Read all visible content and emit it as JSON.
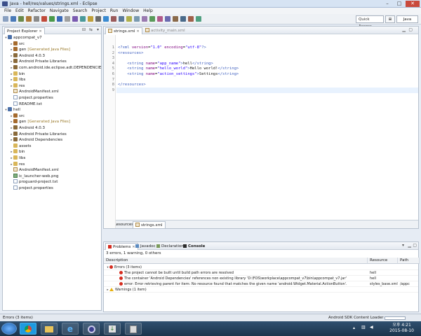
{
  "window": {
    "title": "Java - hell/res/values/strings.xml - Eclipse",
    "minimize": "–",
    "maximize": "□",
    "close": "✕"
  },
  "menu": [
    "File",
    "Edit",
    "Refactor",
    "Navigate",
    "Search",
    "Project",
    "Run",
    "Window",
    "Help"
  ],
  "toolbar": {
    "quick_access": "Quick Access",
    "perspective_java": "Java"
  },
  "explorer": {
    "title": "Project Explorer",
    "rows": [
      {
        "label": "appcompat_v7",
        "icon": "proj",
        "indent": 0,
        "twisty": "▾"
      },
      {
        "label": "src",
        "icon": "pkg",
        "indent": 1,
        "twisty": "▸"
      },
      {
        "label": "gen",
        "suffix": "[Generated Java Files]",
        "icon": "pkg",
        "indent": 1,
        "twisty": "▸"
      },
      {
        "label": "Android 4.0.3",
        "icon": "lib",
        "indent": 1,
        "twisty": "▸"
      },
      {
        "label": "Android Private Libraries",
        "icon": "lib",
        "indent": 1,
        "twisty": "▸"
      },
      {
        "label": "com.android.ide.eclipse.adt.DEPENDENCIES",
        "icon": "lib",
        "indent": 1,
        "twisty": "▸"
      },
      {
        "label": "bin",
        "icon": "folder",
        "indent": 1,
        "twisty": "▸"
      },
      {
        "label": "libs",
        "icon": "folder",
        "indent": 1,
        "twisty": "▸"
      },
      {
        "label": "res",
        "icon": "folder",
        "indent": 1,
        "twisty": "▸"
      },
      {
        "label": "AndroidManifest.xml",
        "icon": "xml",
        "indent": 1,
        "twisty": ""
      },
      {
        "label": "project.properties",
        "icon": "file",
        "indent": 1,
        "twisty": ""
      },
      {
        "label": "README.txt",
        "icon": "file",
        "indent": 1,
        "twisty": ""
      },
      {
        "label": "hell",
        "icon": "proj",
        "indent": 0,
        "twisty": "▾"
      },
      {
        "label": "src",
        "icon": "pkg",
        "indent": 1,
        "twisty": "▸"
      },
      {
        "label": "gen",
        "suffix": "[Generated Java Files]",
        "icon": "pkg",
        "indent": 1,
        "twisty": "▸"
      },
      {
        "label": "Android 4.0.3",
        "icon": "lib",
        "indent": 1,
        "twisty": "▸"
      },
      {
        "label": "Android Private Libraries",
        "icon": "lib",
        "indent": 1,
        "twisty": "▸"
      },
      {
        "label": "Android Dependencies",
        "icon": "lib",
        "indent": 1,
        "twisty": "▸"
      },
      {
        "label": "assets",
        "icon": "folder",
        "indent": 1,
        "twisty": ""
      },
      {
        "label": "bin",
        "icon": "folder",
        "indent": 1,
        "twisty": "▸"
      },
      {
        "label": "libs",
        "icon": "folder",
        "indent": 1,
        "twisty": "▸"
      },
      {
        "label": "res",
        "icon": "folder",
        "indent": 1,
        "twisty": "▸"
      },
      {
        "label": "AndroidManifest.xml",
        "icon": "xml",
        "indent": 1,
        "twisty": ""
      },
      {
        "label": "ic_launcher-web.png",
        "icon": "img",
        "indent": 1,
        "twisty": ""
      },
      {
        "label": "proguard-project.txt",
        "icon": "file",
        "indent": 1,
        "twisty": ""
      },
      {
        "label": "project.properties",
        "icon": "file",
        "indent": 1,
        "twisty": ""
      }
    ]
  },
  "editor": {
    "tabs": [
      {
        "label": "strings.xml",
        "active": true
      },
      {
        "label": "activity_main.xml",
        "active": false
      }
    ],
    "lines": [
      [
        {
          "t": "<?xml ",
          "c": "tagc"
        },
        {
          "t": "version",
          "c": "attrc"
        },
        {
          "t": "=",
          "c": ""
        },
        {
          "t": "\"1.0\"",
          "c": "valc"
        },
        {
          "t": " encoding",
          "c": "attrc"
        },
        {
          "t": "=",
          "c": ""
        },
        {
          "t": "\"utf-8\"",
          "c": "valc"
        },
        {
          "t": "?>",
          "c": "tagc"
        }
      ],
      [
        {
          "t": "<resources>",
          "c": "tagc"
        }
      ],
      [],
      [
        {
          "t": "    <string ",
          "c": "tagc"
        },
        {
          "t": "name",
          "c": "attrc"
        },
        {
          "t": "=",
          "c": ""
        },
        {
          "t": "\"app_name\"",
          "c": "valc"
        },
        {
          "t": ">",
          "c": "tagc"
        },
        {
          "t": "hell",
          "c": ""
        },
        {
          "t": "</string>",
          "c": "tagc"
        }
      ],
      [
        {
          "t": "    <string ",
          "c": "tagc"
        },
        {
          "t": "name",
          "c": "attrc"
        },
        {
          "t": "=",
          "c": ""
        },
        {
          "t": "\"hello_world\"",
          "c": "valc"
        },
        {
          "t": ">",
          "c": "tagc"
        },
        {
          "t": "Hello world!",
          "c": ""
        },
        {
          "t": "</string>",
          "c": "tagc"
        }
      ],
      [
        {
          "t": "    <string ",
          "c": "tagc"
        },
        {
          "t": "name",
          "c": "attrc"
        },
        {
          "t": "=",
          "c": ""
        },
        {
          "t": "\"action_settings\"",
          "c": "valc"
        },
        {
          "t": ">",
          "c": "tagc"
        },
        {
          "t": "Settings",
          "c": ""
        },
        {
          "t": "</string>",
          "c": "tagc"
        }
      ],
      [],
      [
        {
          "t": "</resources>",
          "c": "tagc"
        }
      ],
      []
    ],
    "current_line": 9,
    "bottom_tabs": [
      "Resources",
      "strings.xml"
    ]
  },
  "problems": {
    "tabs": [
      {
        "label": "Problems",
        "active": true
      },
      {
        "label": "Javadoc",
        "active": false
      },
      {
        "label": "Declaration",
        "active": false
      },
      {
        "label": "Console",
        "active": false
      }
    ],
    "summary": "3 errors, 1 warning, 0 others",
    "columns": [
      "Description",
      "Resource",
      "Path"
    ],
    "rows": [
      {
        "type": "group",
        "twisty": "▾",
        "icon": "err",
        "desc": "Errors (3 items)",
        "resource": "",
        "path": ""
      },
      {
        "type": "item",
        "icon": "err",
        "desc": "The project cannot be built until build path errors are resolved",
        "resource": "hell",
        "path": ""
      },
      {
        "type": "item",
        "icon": "err",
        "desc": "The container 'Android Dependencies' references non existing library 'D:\\FOS\\workplace\\appcompat_v7\\bin\\appcompat_v7.jar'",
        "resource": "hell",
        "path": ""
      },
      {
        "type": "item",
        "icon": "err",
        "desc": "error: Error retrieving parent for item: No resource found that matches the given name 'android:Widget.Material.ActionButton'.",
        "resource": "styles_base.xml",
        "path": "/appc"
      },
      {
        "type": "group",
        "twisty": "▸",
        "icon": "warn",
        "desc": "Warnings (1 item)",
        "resource": "",
        "path": ""
      }
    ]
  },
  "status": {
    "left": "Errors (3 items)",
    "right": "Android SDK Content Loader"
  },
  "taskbar": {
    "clock_line1": "오후 4:21",
    "clock_line2": "2015-08-10"
  }
}
